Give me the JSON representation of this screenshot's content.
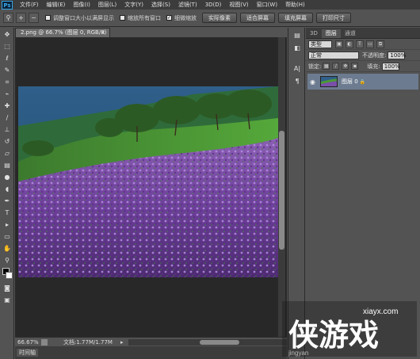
{
  "app": {
    "logo": "Ps"
  },
  "menu": [
    "文件(F)",
    "编辑(E)",
    "图像(I)",
    "图层(L)",
    "文字(Y)",
    "选择(S)",
    "滤镜(T)",
    "3D(D)",
    "视图(V)",
    "窗口(W)",
    "帮助(H)"
  ],
  "options": {
    "tool_icon": "zoom-icon",
    "resize_windows": "调整窗口大小以满屏显示",
    "zoom_all": "缩放所有窗口",
    "scrubby_zoom": "细微缩放",
    "scrubby_checked": true,
    "btn_actual": "实际像素",
    "btn_fit": "适合屏幕",
    "btn_fill": "填充屏幕",
    "btn_print": "打印尺寸"
  },
  "document": {
    "tab": "2.png @ 66.7% (图层 0, RGB/8)",
    "close": "×"
  },
  "status": {
    "zoom": "66.67%",
    "doc_size": "文档:1.77M/1.77M",
    "arrow": "▸"
  },
  "timeline": {
    "label": "时间轴"
  },
  "panels": {
    "tabs": [
      "3D",
      "图层",
      "通道"
    ],
    "active_tab": 1,
    "kind": "类型",
    "blend_mode": "正常",
    "opacity_label": "不透明度:",
    "opacity": "100%",
    "lock_label": "锁定:",
    "fill_label": "填充:",
    "fill": "100%",
    "layer_name": "图层 0"
  },
  "watermark": {
    "text": "侠游戏",
    "url": "xiayx.com",
    "sub": "jingyan"
  },
  "colors": {
    "menubar": "#3c3c3c",
    "panel": "#535353",
    "canvas": "#282828",
    "selected_layer": "#6c7b8f"
  }
}
